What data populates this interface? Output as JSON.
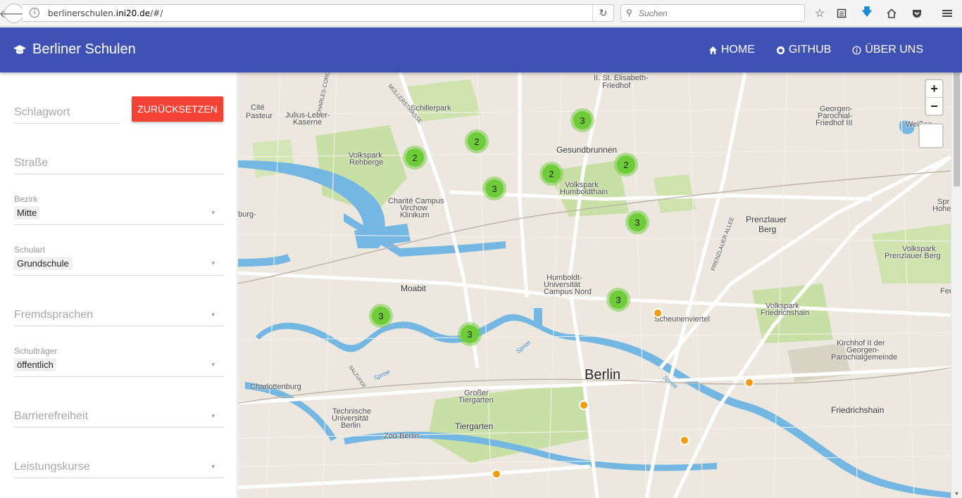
{
  "browser": {
    "url_prefix": "berlinerschulen.",
    "url_domain": "ini20.de",
    "url_path": "/#/",
    "search_placeholder": "Suchen"
  },
  "header": {
    "title": "Berliner Schulen",
    "nav": [
      "HOME",
      "GITHUB",
      "ÜBER UNS"
    ]
  },
  "sidebar": {
    "keyword_placeholder": "Schlagwort",
    "reset_label": "ZURÜCKSETZEN",
    "street_placeholder": "Straße",
    "bezirk": {
      "label": "Bezirk",
      "value": "Mitte"
    },
    "schulart": {
      "label": "Schulart",
      "value": "Grundschule"
    },
    "fremdsprachen_placeholder": "Fremdsprachen",
    "schultraeger": {
      "label": "Schulträger",
      "value": "öffentlich"
    },
    "barrierefreiheit_placeholder": "Barrierefreiheit",
    "leistungskurse_placeholder": "Leistungskurse"
  },
  "map": {
    "zoom_in": "+",
    "zoom_out": "−",
    "labels": [
      "II. St. Elisabeth-",
      "Friedhof",
      "Cité",
      "Pasteur",
      "Julius-Leber-",
      "Kaserne",
      "MÜLLERSTRASSE",
      "Schillerpark",
      "CHARLES-CORCELLE-RING",
      "Volkspark",
      "Rehberge",
      "Gesundbrunnen",
      "Georgen-",
      "Parochial-",
      "Friedhof III",
      "Weißen",
      "Volkspark",
      "Humboldthain",
      "Charité Campus",
      "Virchow",
      "Klinikum",
      "burg-",
      "Spr",
      "Hohen",
      "Prenzlauer",
      "Berg",
      "Volkspark",
      "Prenzlauer Berg",
      "Humboldt-",
      "Universität",
      "Campus Nord",
      "Moabit",
      "Fen",
      "PRENZLAUER ALLEE",
      "Volkspark",
      "Friedrichshain",
      "Scheunenviertel",
      "Kirchhof II der",
      "Georgen-",
      "Parochialgemeinde",
      "Spree",
      "Charlottenburg",
      "SALZUFER",
      "Spree",
      "Berlin",
      "Spree",
      "Technische",
      "Universität",
      "Berlin",
      "Großer",
      "Tiergarten",
      "Friedrichshain",
      "Tiergarten",
      "Zoo Berlin"
    ],
    "clusters": [
      "3",
      "2",
      "2",
      "3",
      "2",
      "2",
      "3",
      "3",
      "3",
      "3"
    ],
    "markers": [
      "marker-1",
      "marker-2",
      "marker-3",
      "marker-4",
      "marker-5"
    ]
  },
  "colors": {
    "header": "#3f51b5",
    "reset_button": "#f44336",
    "cluster": "#6ecc39",
    "marker": "#f39c12",
    "water": "#75b7e3",
    "park": "#c8dfa6"
  }
}
